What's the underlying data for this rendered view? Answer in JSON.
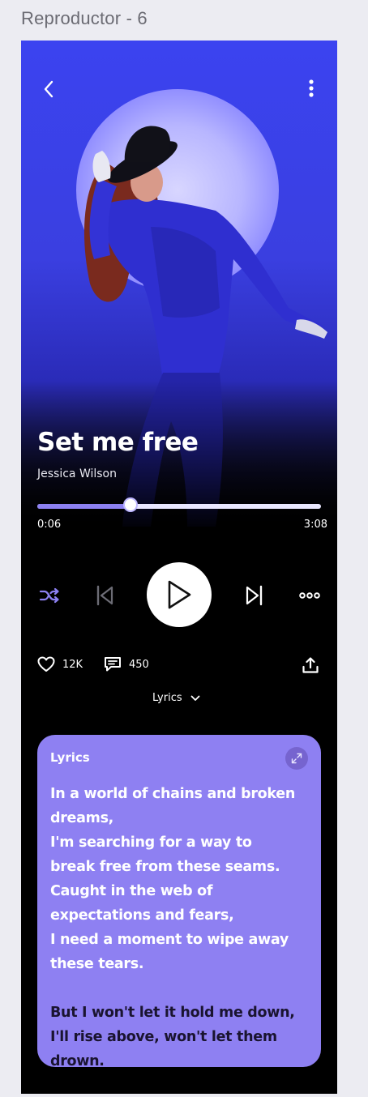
{
  "frame_label": "Reproductor - 6",
  "header": {
    "back_icon": "chevron-left-icon",
    "menu_icon": "vertical-dots-icon"
  },
  "song": {
    "title": "Set me free",
    "artist": "Jessica Wilson"
  },
  "player": {
    "elapsed": "0:06",
    "duration": "3:08",
    "progress_fraction": 0.33,
    "shuffle_color": "#8d81f2"
  },
  "stats": {
    "likes": "12K",
    "comments": "450"
  },
  "lyrics_toggle": {
    "label": "Lyrics"
  },
  "lyrics_card": {
    "title": "Lyrics",
    "lines_active": [
      "In a world of chains and broken",
      "dreams,",
      "I'm searching for a way to",
      "break free from these seams.",
      "Caught in the web of",
      "expectations and fears,",
      "I need a moment to wipe away",
      "these tears."
    ],
    "lines_upcoming": [
      "But I won't let it hold me down,",
      "I'll rise above, won't let them",
      "drown."
    ]
  },
  "colors": {
    "accent": "#8d81f2",
    "card_bg": "#8e80f2",
    "active_text": "#ffffff",
    "upcoming_text": "#1a1430",
    "hero_blue": "#3b43f0"
  }
}
